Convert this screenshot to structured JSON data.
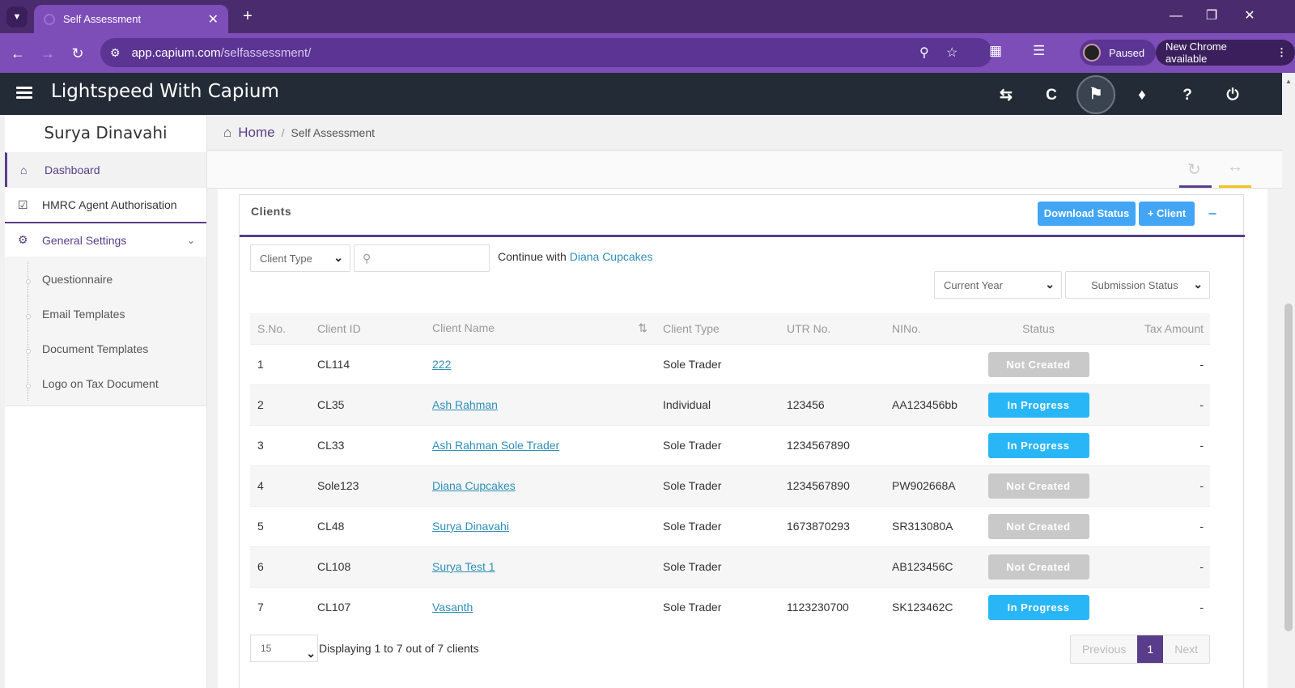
{
  "browser": {
    "tab_title": "Self Assessment",
    "url_host": "app.capium.com",
    "url_path": "/selfassessment/",
    "profile_status": "Paused",
    "update_label": "New Chrome available"
  },
  "app": {
    "title": "Lightspeed With Capium"
  },
  "sidebar": {
    "user_name": "Surya Dinavahi",
    "items": [
      {
        "label": "Dashboard"
      },
      {
        "label": "HMRC Agent Authorisation"
      },
      {
        "label": "General Settings"
      }
    ],
    "sub_items": [
      {
        "label": "Questionnaire"
      },
      {
        "label": "Email Templates"
      },
      {
        "label": "Document Templates"
      },
      {
        "label": "Logo on Tax Document"
      }
    ]
  },
  "breadcrumb": {
    "home": "Home",
    "current": "Self Assessment"
  },
  "panel": {
    "title": "Clients",
    "download_label": "Download Status",
    "add_client_label": "+ Client",
    "client_type_placeholder": "Client Type",
    "continue_prefix": "Continue with",
    "continue_client": "Diana Cupcakes",
    "year_filter": "Current Year",
    "submission_filter": "Submission Status"
  },
  "table": {
    "headers": [
      "S.No.",
      "Client ID",
      "Client Name",
      "Client Type",
      "UTR No.",
      "NINo.",
      "Status",
      "Tax Amount"
    ],
    "rows": [
      {
        "sno": "1",
        "id": "CL114",
        "name": "222",
        "type": "Sole Trader",
        "utr": "",
        "nino": "",
        "status": "Not Created",
        "tax": "-"
      },
      {
        "sno": "2",
        "id": "CL35",
        "name": "Ash Rahman",
        "type": "Individual",
        "utr": "123456",
        "nino": "AA123456bb",
        "status": "In Progress",
        "tax": "-"
      },
      {
        "sno": "3",
        "id": "CL33",
        "name": "Ash Rahman Sole Trader",
        "type": "Sole Trader",
        "utr": "1234567890",
        "nino": "",
        "status": "In Progress",
        "tax": "-"
      },
      {
        "sno": "4",
        "id": "Sole123",
        "name": "Diana Cupcakes",
        "type": "Sole Trader",
        "utr": "1234567890",
        "nino": "PW902668A",
        "status": "Not Created",
        "tax": "-"
      },
      {
        "sno": "5",
        "id": "CL48",
        "name": "Surya Dinavahi",
        "type": "Sole Trader",
        "utr": "1673870293",
        "nino": "SR313080A",
        "status": "Not Created",
        "tax": "-"
      },
      {
        "sno": "6",
        "id": "CL108",
        "name": "Surya Test 1",
        "type": "Sole Trader",
        "utr": "",
        "nino": "AB123456C",
        "status": "Not Created",
        "tax": "-"
      },
      {
        "sno": "7",
        "id": "CL107",
        "name": "Vasanth",
        "type": "Sole Trader",
        "utr": "1123230700",
        "nino": "SK123462C",
        "status": "In Progress",
        "tax": "-"
      }
    ]
  },
  "pagination": {
    "page_size": "15",
    "summary": "Displaying 1 to 7 out of 7 clients",
    "previous": "Previous",
    "current_page": "1",
    "next": "Next"
  },
  "colors": {
    "accent": "#5a3d8a",
    "status_in_progress": "#29b6f6",
    "status_not_created": "#c9c9c9",
    "button_blue": "#42a5f5"
  }
}
